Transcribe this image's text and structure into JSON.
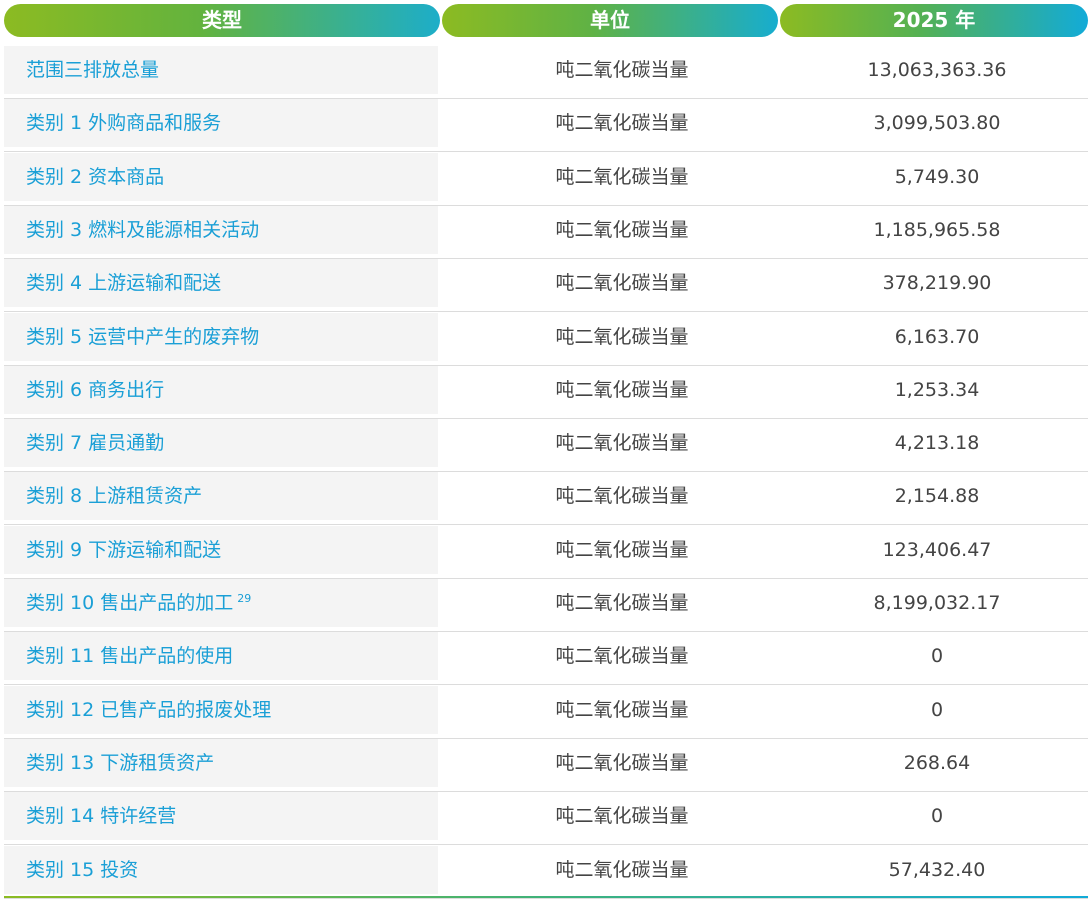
{
  "header": {
    "col_type": "类型",
    "col_unit": "单位",
    "col_year": "2025 年"
  },
  "rows": [
    {
      "type": "范围三排放总量",
      "unit": "吨二氧化碳当量",
      "value": "13,063,363.36"
    },
    {
      "type": "类别 1 外购商品和服务",
      "unit": "吨二氧化碳当量",
      "value": "3,099,503.80"
    },
    {
      "type": "类别 2 资本商品",
      "unit": "吨二氧化碳当量",
      "value": "5,749.30"
    },
    {
      "type": "类别 3 燃料及能源相关活动",
      "unit": "吨二氧化碳当量",
      "value": "1,185,965.58"
    },
    {
      "type": "类别 4 上游运输和配送",
      "unit": "吨二氧化碳当量",
      "value": "378,219.90"
    },
    {
      "type": "类别 5 运营中产生的废弃物",
      "unit": "吨二氧化碳当量",
      "value": "6,163.70"
    },
    {
      "type": "类别 6 商务出行",
      "unit": "吨二氧化碳当量",
      "value": "1,253.34"
    },
    {
      "type": "类别 7 雇员通勤",
      "unit": "吨二氧化碳当量",
      "value": "4,213.18"
    },
    {
      "type": "类别 8 上游租赁资产",
      "unit": "吨二氧化碳当量",
      "value": "2,154.88"
    },
    {
      "type": "类别 9 下游运输和配送",
      "unit": "吨二氧化碳当量",
      "value": "123,406.47"
    },
    {
      "type": "类别 10 售出产品的加工",
      "sup": "29",
      "unit": "吨二氧化碳当量",
      "value": "8,199,032.17"
    },
    {
      "type": "类别 11 售出产品的使用",
      "unit": "吨二氧化碳当量",
      "value": "0"
    },
    {
      "type": "类别 12 已售产品的报废处理",
      "unit": "吨二氧化碳当量",
      "value": "0"
    },
    {
      "type": "类别 13 下游租赁资产",
      "unit": "吨二氧化碳当量",
      "value": "268.64"
    },
    {
      "type": "类别 14 特许经营",
      "unit": "吨二氧化碳当量",
      "value": "0"
    },
    {
      "type": "类别 15 投资",
      "unit": "吨二氧化碳当量",
      "value": "57,432.40"
    }
  ]
}
